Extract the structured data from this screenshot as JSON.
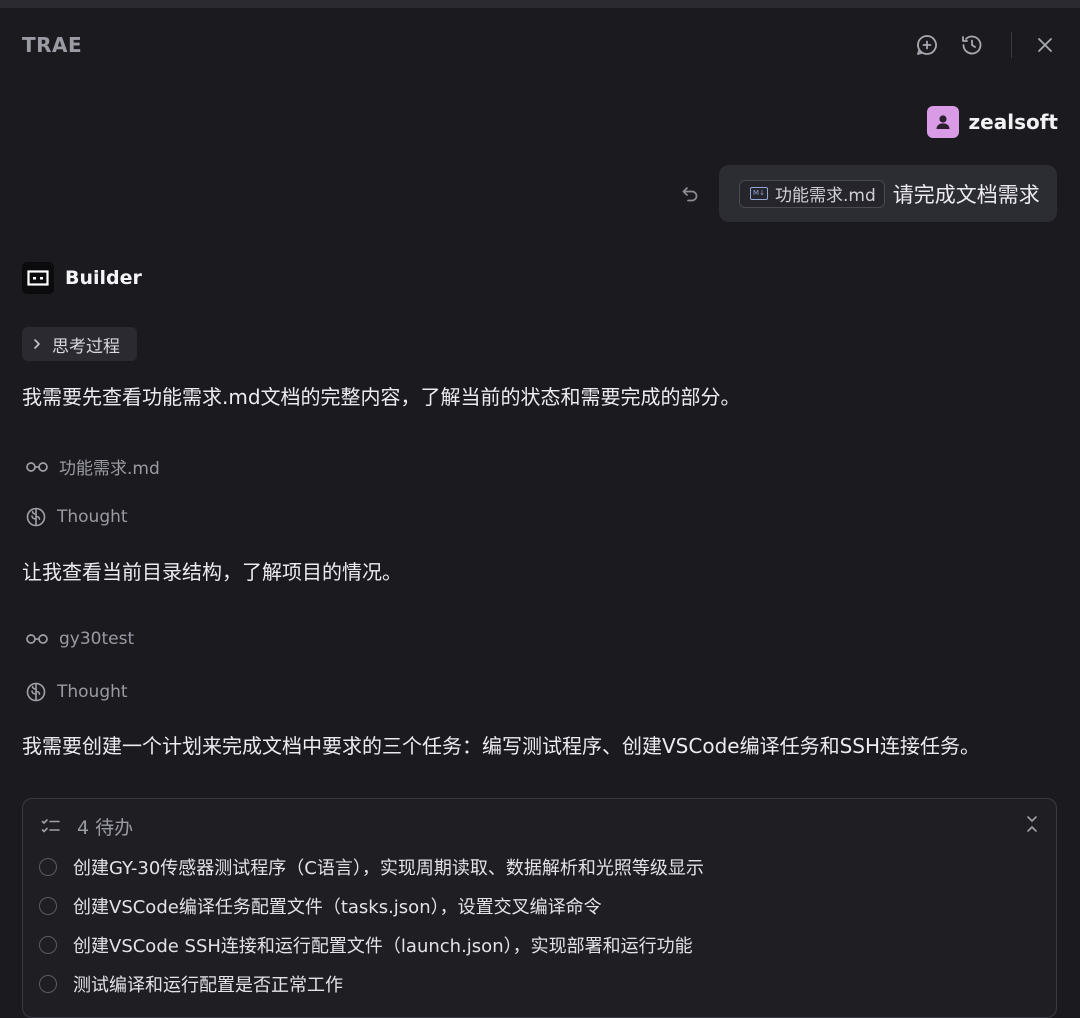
{
  "app": {
    "title": "TRAE"
  },
  "header": {
    "icons": [
      "new-chat-icon",
      "history-icon",
      "close-icon"
    ]
  },
  "user": {
    "name": "zealsoft",
    "attachment": "功能需求.md",
    "message": "请完成文档需求"
  },
  "builder": {
    "name": "Builder",
    "thinking_label": "思考过程",
    "messages": [
      "我需要先查看功能需求.md文档的完整内容，了解当前的状态和需要完成的部分。",
      "让我查看当前目录结构，了解项目的情况。",
      "我需要创建一个计划来完成文档中要求的三个任务：编写测试程序、创建VSCode编译任务和SSH连接任务。"
    ],
    "tools": [
      {
        "icon": "glasses-icon",
        "label": "功能需求.md"
      },
      {
        "icon": "brain-icon",
        "label": "Thought"
      },
      {
        "icon": "glasses-icon",
        "label": "gy30test"
      },
      {
        "icon": "brain-icon",
        "label": "Thought"
      }
    ]
  },
  "todo": {
    "title": "4 待办",
    "items": [
      "创建GY-30传感器测试程序（C语言），实现周期读取、数据解析和光照等级显示",
      "创建VSCode编译任务配置文件（tasks.json），设置交叉编译命令",
      "创建VSCode SSH连接和运行配置文件（launch.json），实现部署和运行功能",
      "测试编译和运行配置是否正常工作"
    ]
  }
}
